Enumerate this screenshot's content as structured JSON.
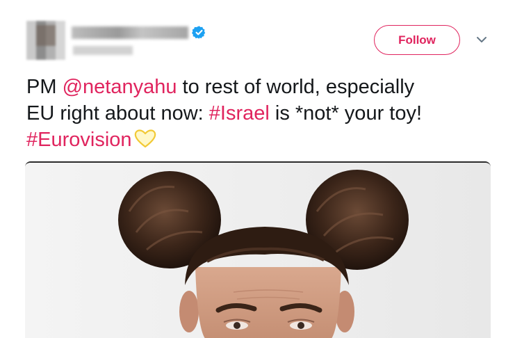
{
  "follow_button": {
    "label": "Follow"
  },
  "icons": {
    "verified": "verified-badge-icon",
    "caret": "chevron-down-icon",
    "heart": "yellow-heart-emoji"
  },
  "tweet": {
    "line1": {
      "prefix": "PM ",
      "mention": "@netanyahu",
      "suffix": " to rest of world, especially"
    },
    "line2": {
      "prefix": "EU right about now: ",
      "hashtag": "#Israel",
      "suffix": " is *not* your toy!"
    },
    "line3": {
      "hashtag": "#Eurovision"
    }
  },
  "colors": {
    "accent": "#e0245e",
    "text": "#14171a",
    "verified": "#1da1f2",
    "heart": "#f7d54a"
  }
}
